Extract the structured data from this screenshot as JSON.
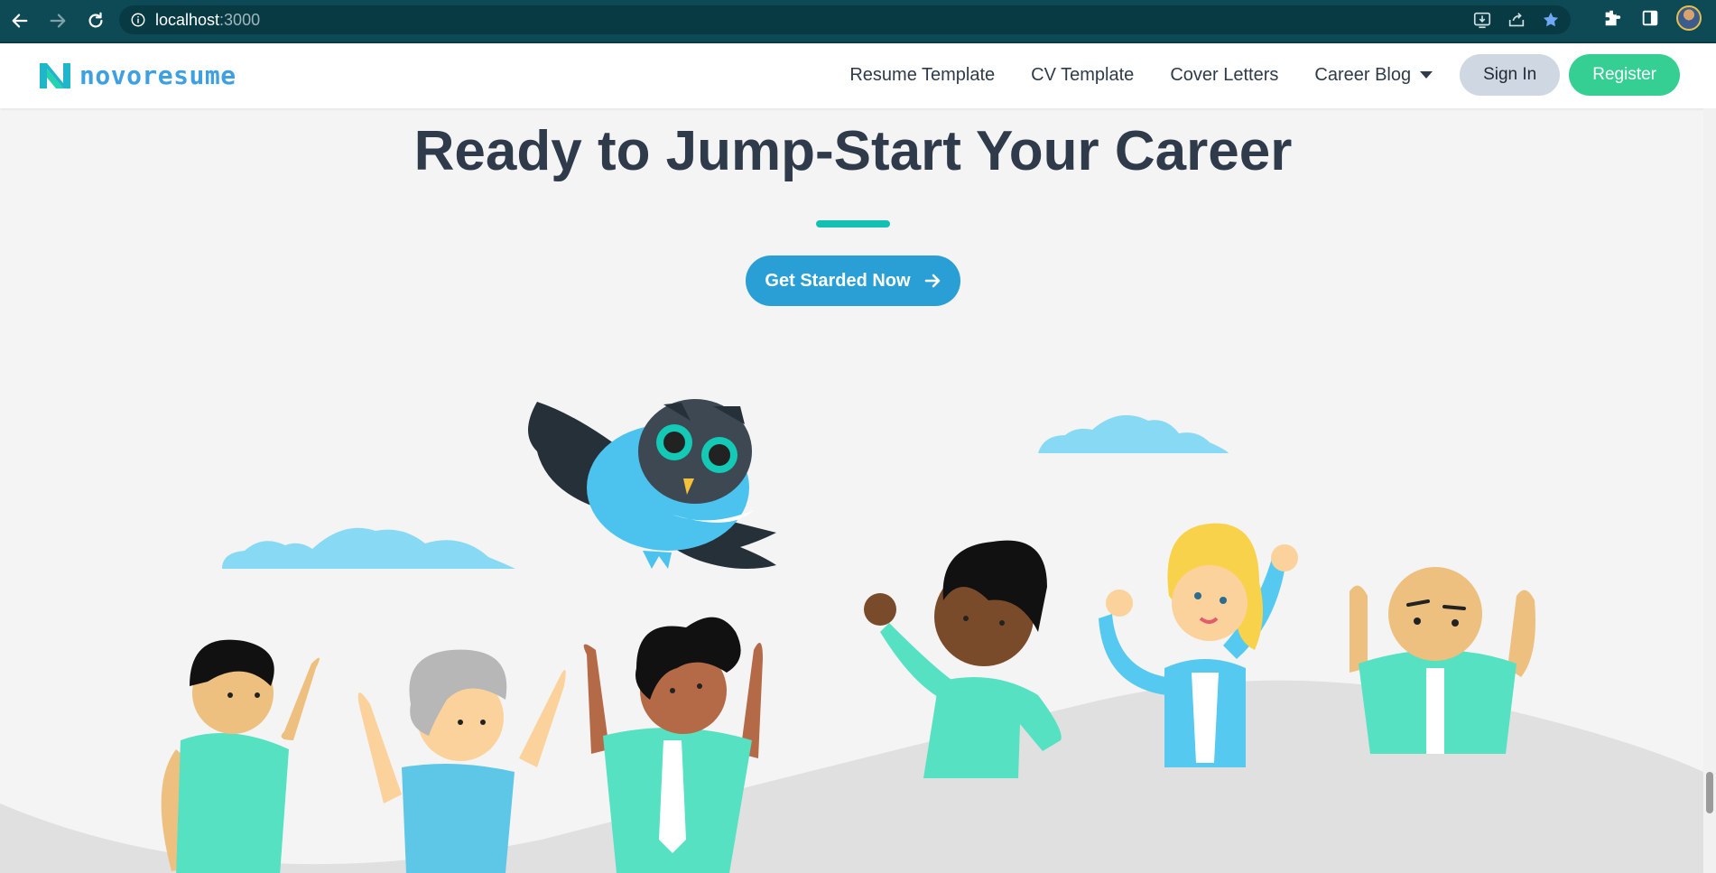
{
  "browser": {
    "url_host": "localhost",
    "url_port": ":3000"
  },
  "header": {
    "logo_text": "novoresume",
    "nav": [
      {
        "label": "Resume Template"
      },
      {
        "label": "CV Template"
      },
      {
        "label": "Cover Letters"
      },
      {
        "label": "Career Blog"
      }
    ],
    "sign_in": "Sign In",
    "register": "Register"
  },
  "hero": {
    "title": "Ready to Jump-Start Your Career",
    "cta_label": "Get Starded Now"
  },
  "colors": {
    "brand_teal": "#14c0b1",
    "cta_blue": "#2a9fd6",
    "register_green": "#35cf94",
    "title_dark": "#2f3b4a"
  },
  "icons": [
    "back-icon",
    "forward-icon",
    "reload-icon",
    "info-icon",
    "install-icon",
    "share-icon",
    "star-icon",
    "extensions-icon",
    "side-panel-icon",
    "arrow-right-icon"
  ]
}
